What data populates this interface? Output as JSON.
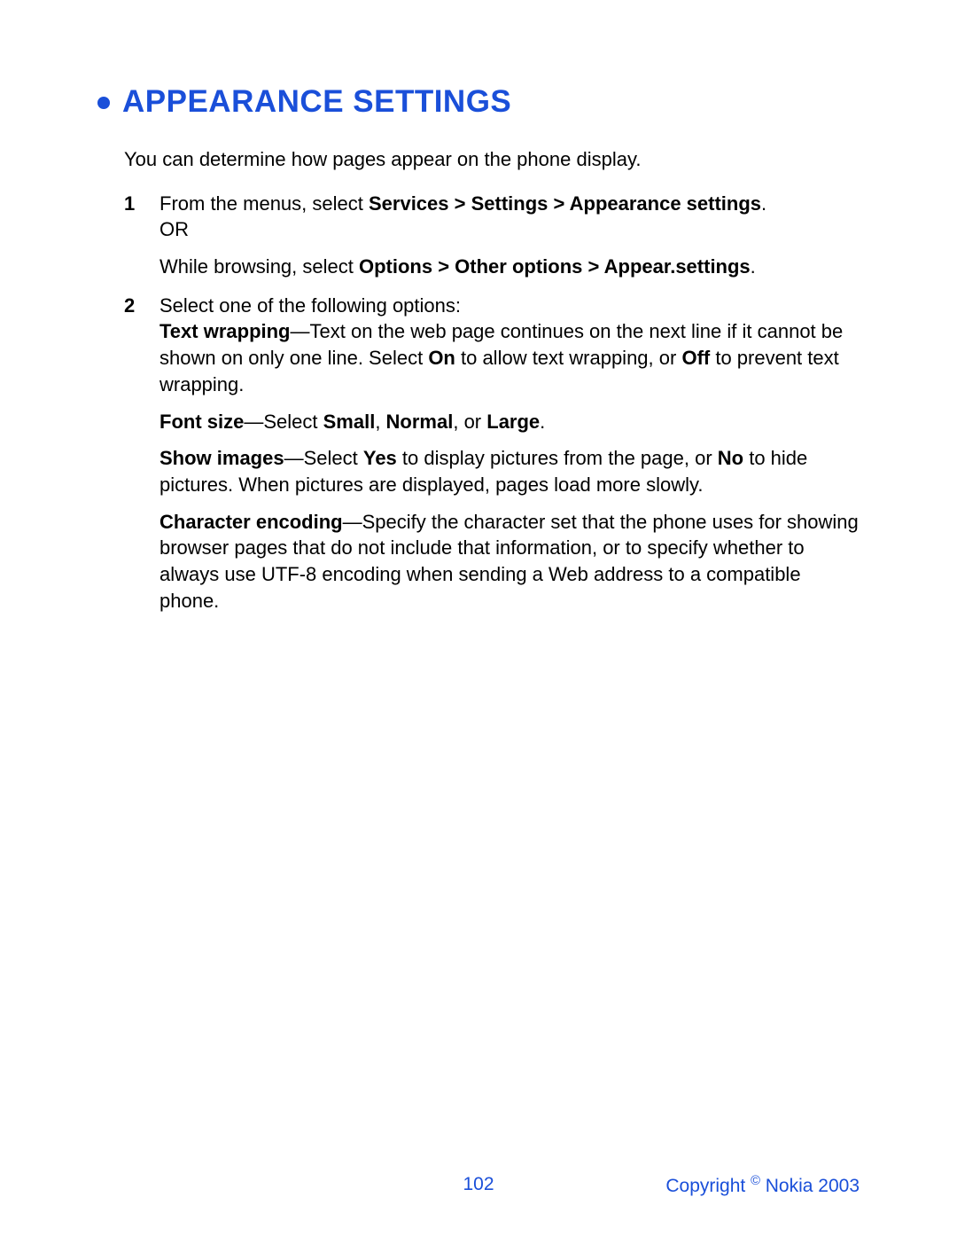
{
  "heading": "APPEARANCE SETTINGS",
  "intro": "You can determine how pages appear on the phone display.",
  "step1": {
    "num": "1",
    "line1_a": "From the menus, select ",
    "line1_b": "Services > Settings > Appearance settings",
    "line1_c": ".",
    "or": "OR",
    "line2_a": "While browsing, select ",
    "line2_b": "Options > Other options > Appear.settings",
    "line2_c": "."
  },
  "step2": {
    "num": "2",
    "opener": "Select one of the following options:",
    "tw_label": "Text wrapping",
    "tw_a": "—Text on the web page continues on the next line if it cannot be shown on only one line. Select ",
    "tw_on": "On",
    "tw_b": " to allow text wrapping, or ",
    "tw_off": "Off",
    "tw_c": " to prevent text wrapping.",
    "fs_label": "Font size",
    "fs_a": "—Select ",
    "fs_small": "Small",
    "fs_sep1": ", ",
    "fs_normal": "Normal",
    "fs_sep2": ", or ",
    "fs_large": "Large",
    "fs_end": ".",
    "si_label": "Show images",
    "si_a": "—Select ",
    "si_yes": "Yes",
    "si_b": " to display pictures from the page, or ",
    "si_no": "No",
    "si_c": " to hide pictures. When pictures are displayed, pages load more slowly.",
    "ce_label": "Character encoding",
    "ce_a": "—Specify the character set that the phone uses for showing browser pages that do not include that information, or to specify whether to always use UTF-8 encoding when sending a Web address to a compatible phone."
  },
  "footer": {
    "page": "102",
    "copy_a": "Copyright ",
    "copy_sym": "©",
    "copy_b": " Nokia 2003"
  }
}
